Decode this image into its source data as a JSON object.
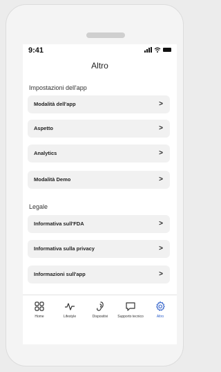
{
  "status": {
    "time": "9:41"
  },
  "page": {
    "title": "Altro"
  },
  "sections": [
    {
      "header": "Impostazioni dell'app",
      "items": [
        "Modalità dell'app",
        "Aspetto",
        "Analytics",
        "Modalità Demo"
      ]
    },
    {
      "header": "Legale",
      "items": [
        "Informativa sull'FDA",
        "Informativa sulla privacy",
        "Informazioni sull'app"
      ]
    }
  ],
  "chevron": ">",
  "tabs": [
    {
      "label": "Home",
      "icon": "grid-icon",
      "active": false
    },
    {
      "label": "Lifestyle",
      "icon": "activity-icon",
      "active": false
    },
    {
      "label": "Dispositivi",
      "icon": "hearing-aid-icon",
      "active": false
    },
    {
      "label": "Supporto tecnico",
      "icon": "chat-bubble-icon",
      "active": false
    },
    {
      "label": "Altro",
      "icon": "gear-icon",
      "active": true
    }
  ],
  "colors": {
    "accent": "#2d5fc9",
    "item_bg": "#f1f1f1"
  }
}
